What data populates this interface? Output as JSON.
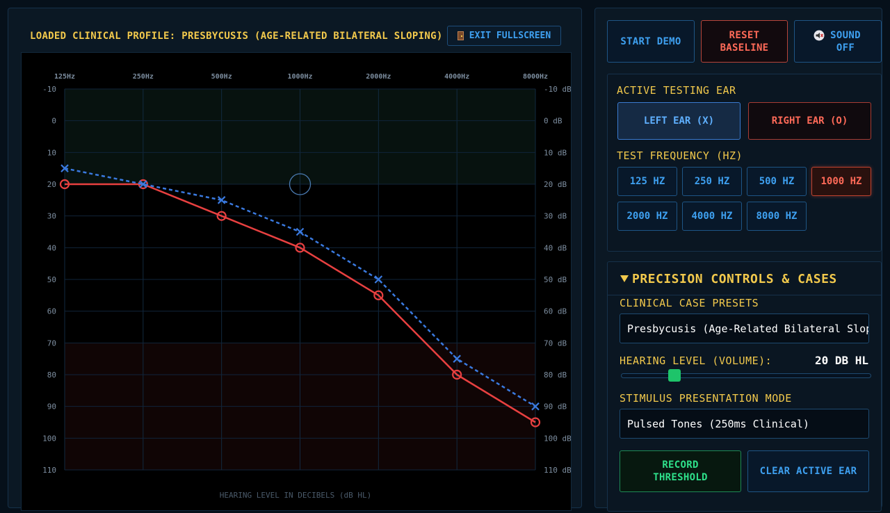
{
  "header": {
    "profile_title": "LOADED CLINICAL PROFILE: PRESBYCUSIS (AGE-RELATED BILATERAL SLOPING)",
    "exit_label": "EXIT FULLSCREEN",
    "exit_icon": "door-icon"
  },
  "chart_data": {
    "type": "line",
    "x": [
      "125Hz",
      "250Hz",
      "500Hz",
      "1000Hz",
      "2000Hz",
      "4000Hz",
      "8000Hz"
    ],
    "xlabel": "HEARING LEVEL IN DECIBELS (dB HL)",
    "ylim": [
      -10,
      110
    ],
    "y_reversed": true,
    "y_ticks_left": [
      "-10",
      "0",
      "10",
      "20",
      "30",
      "40",
      "50",
      "60",
      "70",
      "80",
      "90",
      "100",
      "110"
    ],
    "y_ticks_right": [
      "-10 dB",
      "0 dB",
      "10 dB",
      "20 dB",
      "30 dB",
      "40 dB",
      "50 dB",
      "60 dB",
      "70 dB",
      "80 dB",
      "90 dB",
      "100 dB",
      "110 dB"
    ],
    "grid": true,
    "normal_zone": [
      -10,
      20
    ],
    "severe_zone": [
      70,
      110
    ],
    "series": [
      {
        "name": "",
        "marker": "O",
        "line": "solid",
        "color": "#e84040",
        "values": [
          20,
          20,
          30,
          40,
          55,
          80,
          95
        ]
      },
      {
        "name": "",
        "marker": "X",
        "line": "dashed",
        "color": "#3a7ae0",
        "values": [
          15,
          20,
          25,
          35,
          50,
          75,
          90
        ]
      }
    ],
    "cursor": {
      "x": "1000Hz",
      "y": 20
    }
  },
  "controls": {
    "start_demo": "START DEMO",
    "reset_baseline": "RESET BASELINE",
    "sound_off": "SOUND OFF",
    "sound_icon": "speaker-muted-icon"
  },
  "ear": {
    "heading": "ACTIVE TESTING EAR",
    "left": "LEFT EAR (X)",
    "right": "RIGHT EAR (O)",
    "selected": "left"
  },
  "frequency": {
    "heading": "TEST FREQUENCY (HZ)",
    "options": [
      "125 HZ",
      "250 HZ",
      "500 HZ",
      "1000 HZ",
      "2000 HZ",
      "4000 HZ",
      "8000 HZ"
    ],
    "selected": "1000 HZ"
  },
  "precision": {
    "heading": "PRECISION CONTROLS & CASES",
    "presets_label": "CLINICAL CASE PRESETS",
    "preset_value": "Presbycusis (Age-Related Bilateral Sloping)",
    "level_label": "HEARING LEVEL (VOLUME):",
    "level_value": "20 DB HL",
    "level_fraction": 0.2083,
    "stimulus_label": "STIMULUS PRESENTATION MODE",
    "stimulus_value": "Pulsed Tones (250ms Clinical)",
    "record_label": "RECORD THRESHOLD",
    "clear_label": "CLEAR ACTIVE EAR"
  },
  "colors": {
    "accent_blue": "#3ea0f0",
    "accent_red": "#ff6a58",
    "accent_green": "#2ee08a",
    "accent_yellow": "#f2c94c"
  }
}
